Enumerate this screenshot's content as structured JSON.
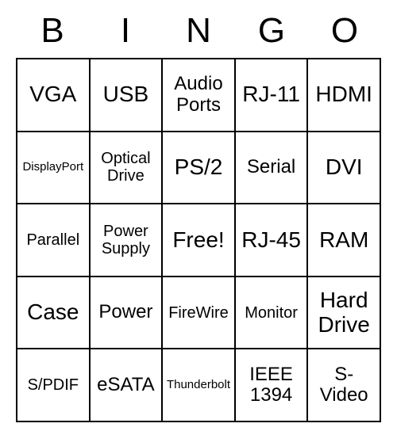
{
  "header": [
    "B",
    "I",
    "N",
    "G",
    "O"
  ],
  "cells": [
    [
      {
        "label": "VGA",
        "size": "lg"
      },
      {
        "label": "USB",
        "size": "lg"
      },
      {
        "label": "Audio Ports",
        "size": "md"
      },
      {
        "label": "RJ-11",
        "size": "lg"
      },
      {
        "label": "HDMI",
        "size": "lg"
      }
    ],
    [
      {
        "label": "DisplayPort",
        "size": "xs"
      },
      {
        "label": "Optical Drive",
        "size": "sm"
      },
      {
        "label": "PS/2",
        "size": "lg"
      },
      {
        "label": "Serial",
        "size": "md"
      },
      {
        "label": "DVI",
        "size": "lg"
      }
    ],
    [
      {
        "label": "Parallel",
        "size": "sm"
      },
      {
        "label": "Power Supply",
        "size": "sm"
      },
      {
        "label": "Free!",
        "size": "lg"
      },
      {
        "label": "RJ-45",
        "size": "lg"
      },
      {
        "label": "RAM",
        "size": "lg"
      }
    ],
    [
      {
        "label": "Case",
        "size": "lg"
      },
      {
        "label": "Power",
        "size": "md"
      },
      {
        "label": "FireWire",
        "size": "sm"
      },
      {
        "label": "Monitor",
        "size": "sm"
      },
      {
        "label": "Hard Drive",
        "size": "lg"
      }
    ],
    [
      {
        "label": "S/PDIF",
        "size": "sm"
      },
      {
        "label": "eSATA",
        "size": "md"
      },
      {
        "label": "Thunderbolt",
        "size": "xs"
      },
      {
        "label": "IEEE 1394",
        "size": "md"
      },
      {
        "label": "S-Video",
        "size": "md"
      }
    ]
  ]
}
